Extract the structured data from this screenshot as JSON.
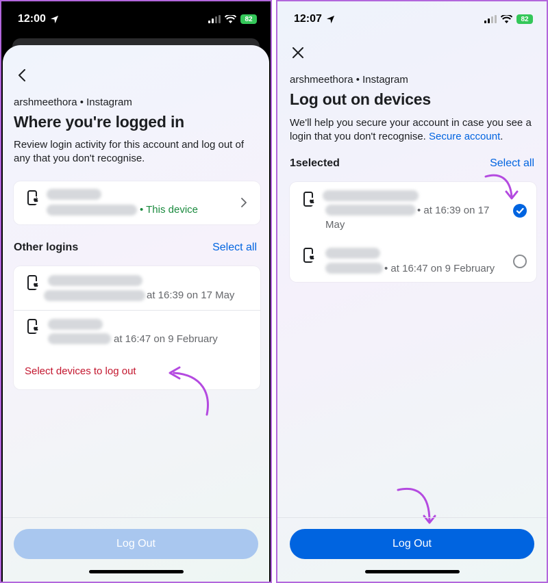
{
  "left": {
    "status": {
      "time": "12:00",
      "battery": "82"
    },
    "account_line": "arshmeethora • Instagram",
    "title": "Where you're logged in",
    "description": "Review login activity for this account and log out of any that you don't recognise.",
    "this_device": {
      "suffix": "• This device"
    },
    "other_logins": {
      "label": "Other logins",
      "select_all": "Select all",
      "items": [
        {
          "meta": "at 16:39 on 17 May"
        },
        {
          "meta": "at 16:47 on 9 February"
        }
      ],
      "select_devices_link": "Select devices to log out"
    },
    "logout_button": "Log Out"
  },
  "right": {
    "status": {
      "time": "12:07",
      "battery": "82"
    },
    "account_line": "arshmeethora • Instagram",
    "title": "Log out on devices",
    "description_prefix": "We'll help you secure your account in case you see a login that you don't recognise.",
    "secure_link": "Secure account",
    "description_suffix": ".",
    "selected_count": "1selected",
    "select_all": "Select all",
    "items": [
      {
        "meta_line1": "• at 16:39 on 17",
        "meta_line2": "May",
        "selected": true
      },
      {
        "meta_line1": "• at 16:47 on 9 February",
        "selected": false
      }
    ],
    "logout_button": "Log Out"
  },
  "colors": {
    "accent": "#0064e0",
    "danger": "#c3162e",
    "green": "#1a8a3e",
    "annotation_arrow": "#b44ae0"
  },
  "icons": [
    "location-arrow-icon",
    "signal-icon",
    "wifi-icon",
    "battery-icon",
    "back-chevron-icon",
    "close-icon",
    "phone-apple-icon",
    "chevron-right-icon",
    "checkmark-icon"
  ]
}
